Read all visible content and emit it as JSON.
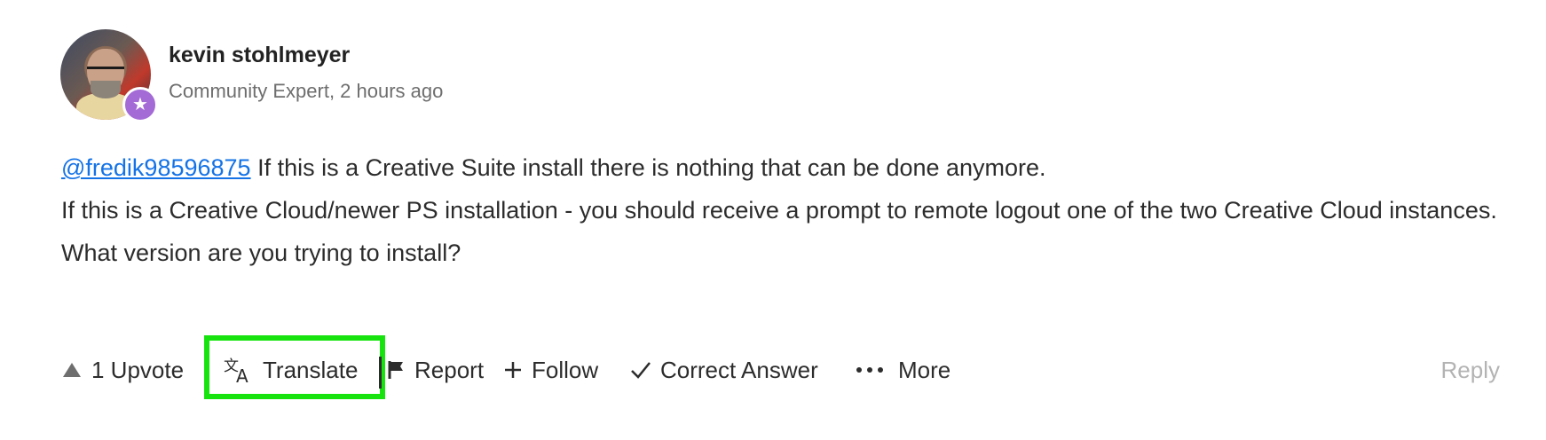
{
  "author": {
    "name": "kevin stohlmeyer",
    "meta": "Community Expert, 2 hours ago",
    "avatar_icon": "user-avatar",
    "badge_icon": "star-badge-icon"
  },
  "post": {
    "mention": "@fredik98596875",
    "line1": " If this is a Creative Suite install there is nothing that can be done anymore.",
    "line2": "If this is a Creative Cloud/newer PS installation - you should receive a prompt to remote logout one of the two Creative Cloud instances.",
    "line3": "What version are you trying to install?"
  },
  "actions": {
    "upvote_label": "1 Upvote",
    "translate_label": "Translate",
    "report_label": "Report",
    "follow_label": "Follow",
    "correct_answer_label": "Correct Answer",
    "more_label": "More",
    "reply_label": "Reply"
  },
  "colors": {
    "mention": "#1473e6",
    "highlight": "#17e40f",
    "badge": "#a46bd6",
    "reply_disabled": "#b3b3b3"
  }
}
